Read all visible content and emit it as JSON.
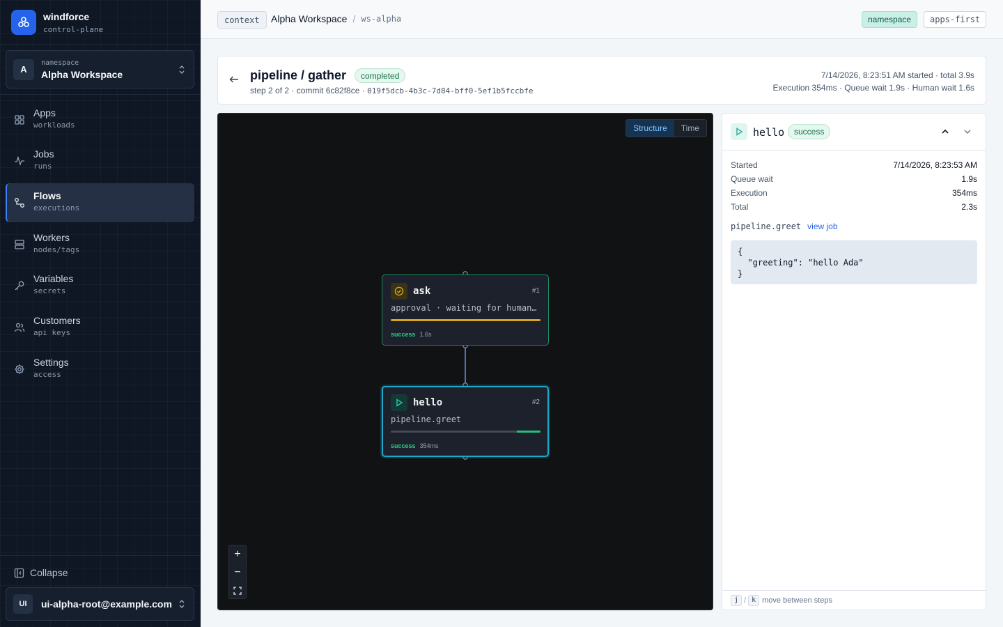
{
  "brand": {
    "name": "windforce",
    "sub": "control-plane"
  },
  "namespace_select": {
    "label": "namespace",
    "name": "Alpha Workspace",
    "avatar": "A"
  },
  "nav": [
    {
      "label": "Apps",
      "sub": "workloads",
      "icon": "grid-icon"
    },
    {
      "label": "Jobs",
      "sub": "runs",
      "icon": "activity-icon"
    },
    {
      "label": "Flows",
      "sub": "executions",
      "icon": "flow-icon",
      "active": true
    },
    {
      "label": "Workers",
      "sub": "nodes/tags",
      "icon": "server-icon"
    },
    {
      "label": "Variables",
      "sub": "secrets",
      "icon": "key-icon"
    },
    {
      "label": "Customers",
      "sub": "api keys",
      "icon": "users-icon"
    },
    {
      "label": "Settings",
      "sub": "access",
      "icon": "gear-icon"
    }
  ],
  "collapse_label": "Collapse",
  "user": {
    "avatar": "UI",
    "email": "ui-alpha-root@example.com"
  },
  "topbar": {
    "context_chip": "context",
    "workspace_name": "Alpha Workspace",
    "separator": "/",
    "workspace_id": "ws-alpha",
    "tag_namespace": "namespace",
    "tag_mode": "apps-first"
  },
  "run": {
    "title": "pipeline / gather",
    "status": "completed",
    "step_text": "step 2 of 2 · commit 6c82f8ce · ",
    "run_id": "019f5dcb-4b3c-7d84-bff0-5ef1b5fccbfe",
    "meta_line1": "7/14/2026, 8:23:51 AM started · total 3.9s",
    "meta_line2": "Execution 354ms · Queue wait 1.9s · Human wait 1.6s"
  },
  "canvas": {
    "view_options": [
      "Structure",
      "Time"
    ],
    "active_view": "Structure",
    "nodes": [
      {
        "name": "ask",
        "num": "#1",
        "desc": "approval · waiting for human…",
        "status": "success",
        "duration": "1.6s",
        "icon": "clock-check-icon",
        "progress_start": 0,
        "progress_end": 1,
        "color": "#d9a51a"
      },
      {
        "name": "hello",
        "num": "#2",
        "desc": "pipeline.greet",
        "status": "success",
        "duration": "354ms",
        "icon": "play-icon",
        "progress_start": 0.84,
        "progress_end": 1,
        "color": "#22c27e"
      }
    ],
    "zoom_controls": {
      "in": "+",
      "out": "−"
    }
  },
  "detail": {
    "title": "hello",
    "status": "success",
    "rows": [
      {
        "key": "Started",
        "value": "7/14/2026, 8:23:53 AM"
      },
      {
        "key": "Queue wait",
        "value": "1.9s"
      },
      {
        "key": "Execution",
        "value": "354ms"
      },
      {
        "key": "Total",
        "value": "2.3s"
      }
    ],
    "function": "pipeline.greet",
    "view_job": "view job",
    "output": "{\n  \"greeting\": \"hello Ada\"\n}",
    "footer": {
      "key1": "j",
      "sep": "/",
      "key2": "k",
      "hint": "move between steps"
    }
  },
  "colors": {
    "accent": "#2563eb",
    "success": "#22c27e",
    "warning": "#d9a51a",
    "selected": "#1fa6c9"
  }
}
